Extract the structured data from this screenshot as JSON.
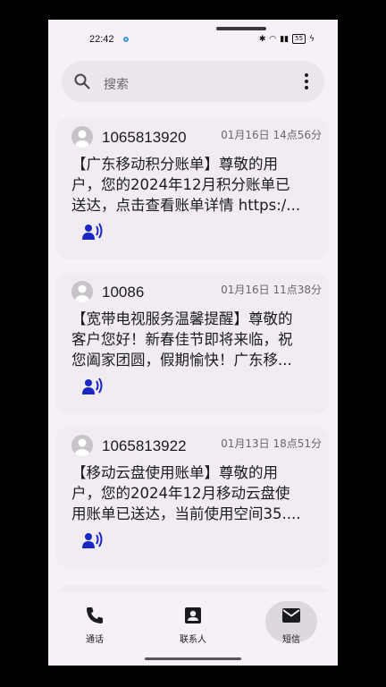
{
  "status": {
    "time": "22:42",
    "battery": "55"
  },
  "search": {
    "placeholder": "搜索"
  },
  "messages": [
    {
      "sender": "1065813920",
      "date": "01月16日 14点56分",
      "preview": "【广东移动积分账单】尊敬的用\n户，您的2024年12月积分账单已\n送达，点击查看账单详情 https:/..."
    },
    {
      "sender": "10086",
      "date": "01月16日 11点38分",
      "preview": "【宽带电视服务温馨提醒】尊敬的\n客户您好！新春佳节即将来临，祝\n您阖家团圆，假期愉快！广东移..."
    },
    {
      "sender": "1065813922",
      "date": "01月13日 18点51分",
      "preview": "【移动云盘使用账单】尊敬的用\n户，您的2024年12月移动云盘使\n用账单已送达，当前使用空间35...."
    }
  ],
  "nav": {
    "tabs": [
      {
        "label": "通话",
        "icon": "phone-icon"
      },
      {
        "label": "联系人",
        "icon": "contacts-icon"
      },
      {
        "label": "短信",
        "icon": "mail-icon"
      }
    ],
    "active": "短信"
  },
  "colors": {
    "accent": "#1a27c4",
    "background": "#f7f1f7",
    "card": "#f0ecf1"
  }
}
